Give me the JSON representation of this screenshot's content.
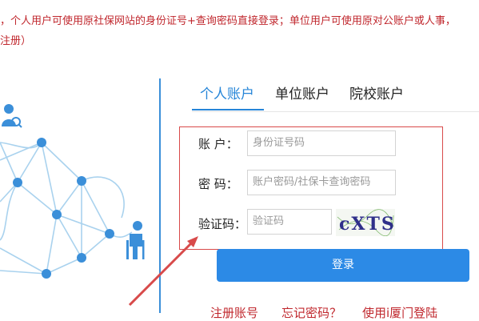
{
  "notice": {
    "line1": "，个人用户可使用原社保网站的身份证号+查询密码直接登录；单位用户可使用原对公账户或人事，",
    "line2": "注册）"
  },
  "tabs": [
    {
      "label": "个人账户",
      "active": true
    },
    {
      "label": "单位账户",
      "active": false
    },
    {
      "label": "院校账户",
      "active": false
    }
  ],
  "form": {
    "account_label": "账 户：",
    "account_placeholder": "身份证号码",
    "password_label": "密 码：",
    "password_placeholder": "账户密码/社保卡查询密码",
    "captcha_label": "验证码：",
    "captcha_placeholder": "验证码",
    "captcha_text": "cXTS"
  },
  "login_button": "登录",
  "links": {
    "register": "注册账号",
    "forgot": "忘记密码？",
    "ixiamen": "使用i厦门登陆"
  },
  "colors": {
    "accent": "#2585d8",
    "button": "#2c8ae6",
    "notice_red": "#c0272d",
    "annotation_red": "#d84a4a"
  }
}
